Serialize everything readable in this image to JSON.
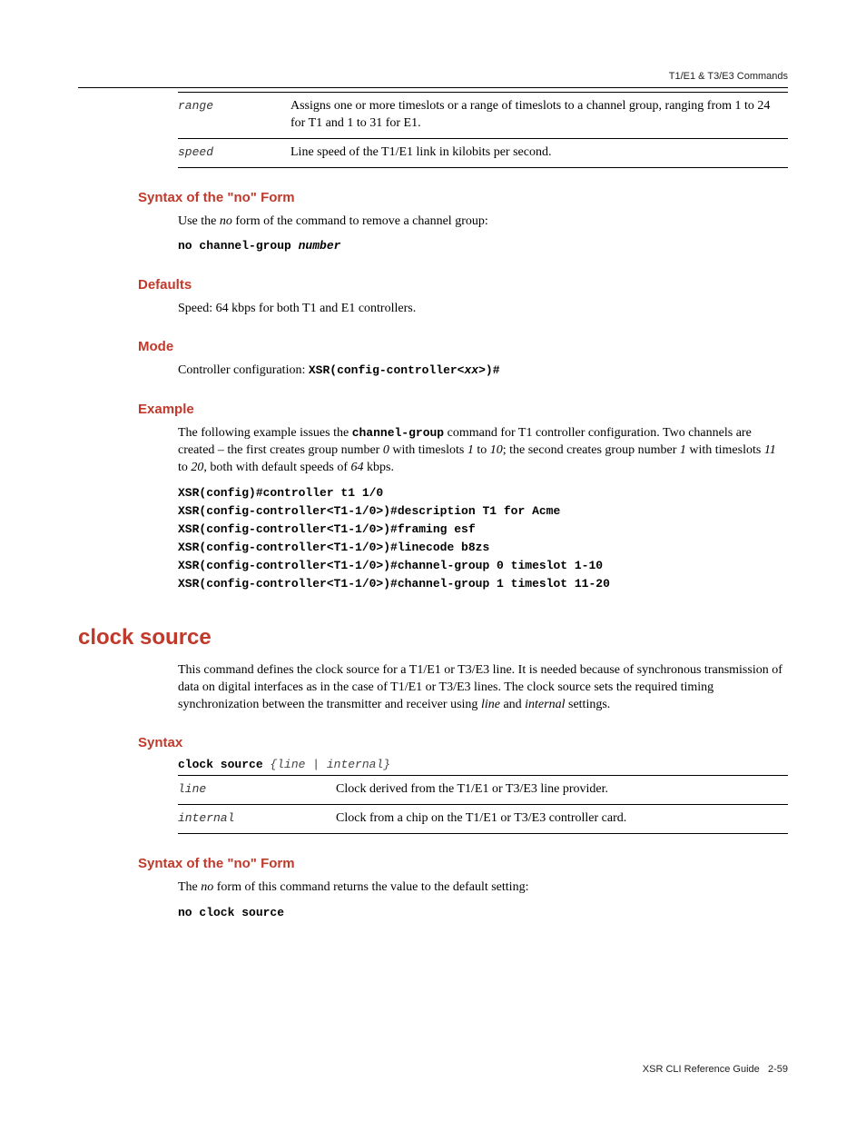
{
  "running_head": "T1/E1 & T3/E3 Commands",
  "params_table": [
    {
      "name": "range",
      "desc": "Assigns one or more timeslots or a range of timeslots to a channel group, ranging from 1 to 24 for T1 and 1 to 31 for E1."
    },
    {
      "name": "speed",
      "desc": "Line speed of the T1/E1 link in kilobits per second."
    }
  ],
  "sections": {
    "syntax_no_form": {
      "heading": "Syntax of the \"no\" Form",
      "text_pre": "Use the ",
      "text_em": "no",
      "text_post": " form of the command to remove a channel group:",
      "code_kw": "no channel-group ",
      "code_arg": "number"
    },
    "defaults": {
      "heading": "Defaults",
      "text": "Speed: 64 kbps for both T1 and E1 controllers."
    },
    "mode": {
      "heading": "Mode",
      "text_pre": "Controller configuration: ",
      "code_pre": "XSR(config-controller<",
      "code_arg": "xx",
      "code_post": ">)#"
    },
    "example": {
      "heading": "Example",
      "para_pre": "The following example issues the ",
      "para_cmd": "channel-group",
      "para_mid": " command for T1 controller configuration. Two channels are created – the first creates group number ",
      "g0": "0",
      "para_mid2": " with timeslots ",
      "ts1": "1",
      "para_to": " to ",
      "ts10": "10",
      "para_mid3": "; the second creates group number ",
      "g1": "1",
      "para_mid4": " with timeslots ",
      "ts11": "11",
      "ts20": "20",
      "para_mid5": ", both with default speeds of ",
      "spd": "64",
      "para_end": " kbps.",
      "code": "XSR(config)#controller t1 1/0\nXSR(config-controller<T1-1/0>)#description T1 for Acme\nXSR(config-controller<T1-1/0>)#framing esf\nXSR(config-controller<T1-1/0>)#linecode b8zs\nXSR(config-controller<T1-1/0>)#channel-group 0 timeslot 1-10\nXSR(config-controller<T1-1/0>)#channel-group 1 timeslot 11-20"
    }
  },
  "command2": {
    "title": "clock source",
    "intro_pre": "This command defines the clock source for a T1/E1 or T3/E3 line. It is needed because of synchronous transmission of data on digital interfaces as in the case of T1/E1 or T3/E3 lines. The clock source sets the required timing synchronization between the transmitter and receiver using ",
    "intro_em1": "line",
    "intro_and": " and ",
    "intro_em2": "internal",
    "intro_post": " settings.",
    "syntax": {
      "heading": "Syntax",
      "line_kw": "clock source",
      "line_args": " {line | internal}",
      "rows": [
        {
          "name": "line",
          "desc": "Clock derived from the T1/E1 or T3/E3 line provider."
        },
        {
          "name": "internal",
          "desc": "Clock from a chip on the T1/E1 or T3/E3 controller card."
        }
      ]
    },
    "syntax_no": {
      "heading": "Syntax of the \"no\" Form",
      "text_pre": "The ",
      "text_em": "no",
      "text_post": " form of this command returns the value to the default setting:",
      "code": "no clock source"
    }
  },
  "footer": {
    "book": "XSR CLI Reference Guide",
    "page": "2-59"
  }
}
